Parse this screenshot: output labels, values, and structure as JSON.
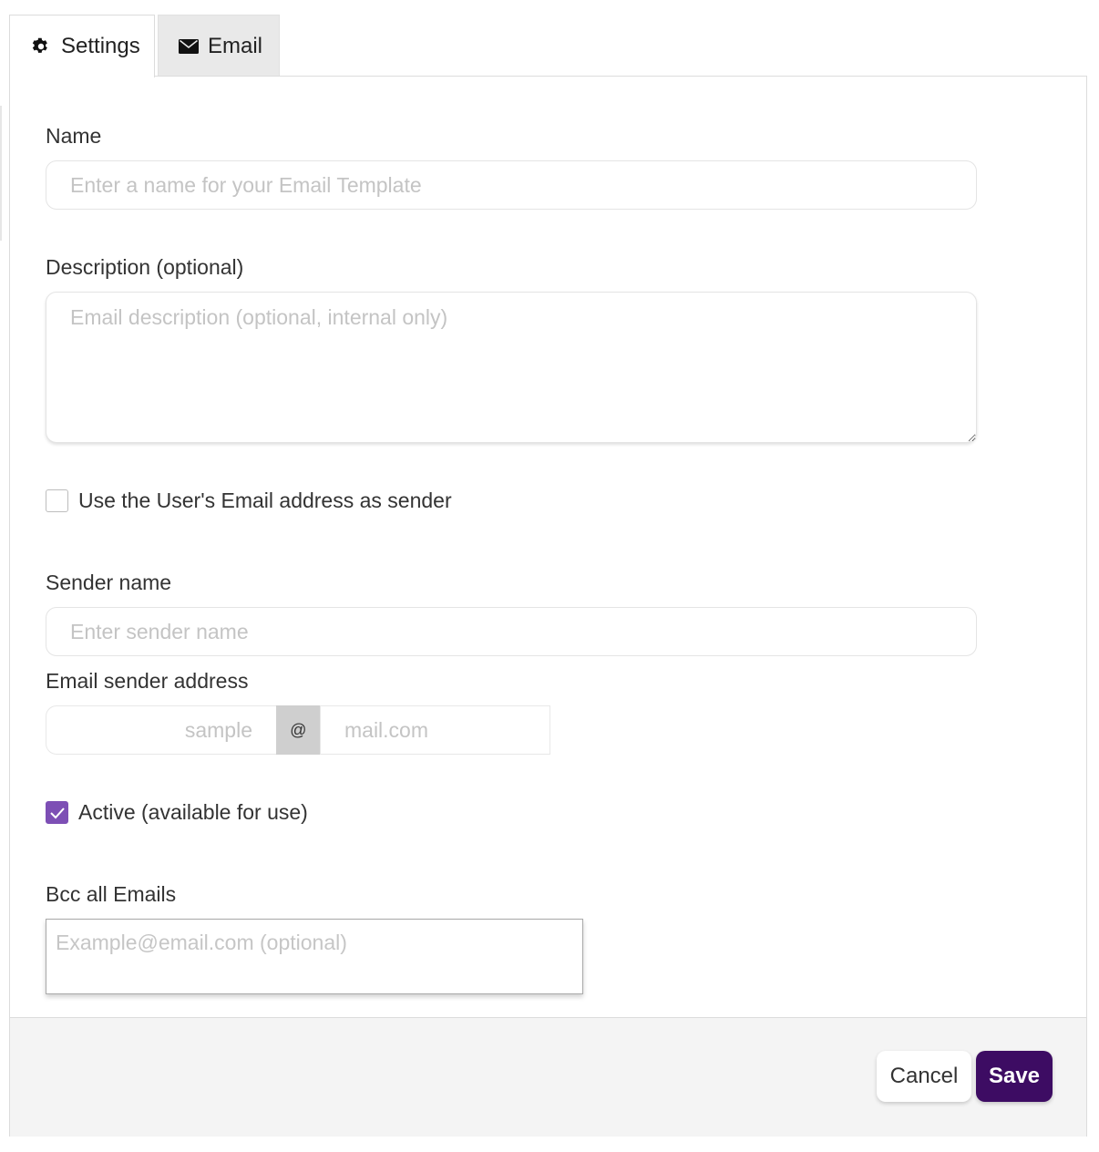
{
  "tabs": [
    {
      "label": "Settings",
      "icon": "gear-icon",
      "active": true
    },
    {
      "label": "Email",
      "icon": "envelope-icon",
      "active": false
    }
  ],
  "form": {
    "name": {
      "label": "Name",
      "placeholder": "Enter a name for your Email Template",
      "value": ""
    },
    "description": {
      "label": "Description (optional)",
      "placeholder": "Email description (optional, internal only)",
      "value": ""
    },
    "use_user_email": {
      "label": "Use the User's Email address as sender",
      "checked": false
    },
    "sender_name": {
      "label": "Sender name",
      "placeholder": "Enter sender name",
      "value": ""
    },
    "sender_address": {
      "label": "Email sender address",
      "local_placeholder": "sample",
      "at_symbol": "@",
      "domain_placeholder": "mail.com"
    },
    "active": {
      "label": "Active (available for use)",
      "checked": true
    },
    "bcc": {
      "label": "Bcc all Emails",
      "placeholder": "Example@email.com (optional)",
      "value": ""
    }
  },
  "footer": {
    "cancel_label": "Cancel",
    "save_label": "Save"
  },
  "colors": {
    "accent": "#7d4fb5",
    "save_button": "#3d0c63",
    "footer_bg": "#f4f4f4"
  }
}
